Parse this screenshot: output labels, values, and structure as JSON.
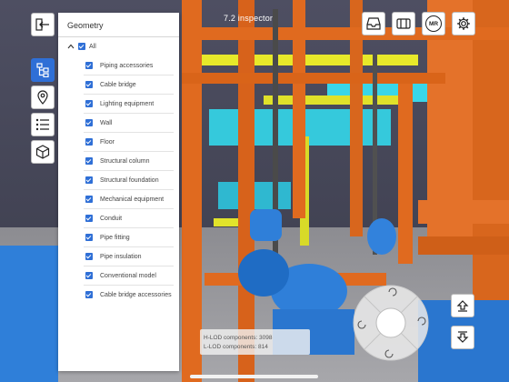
{
  "window": {
    "title": "7.2 inspector"
  },
  "left_toolbar": {
    "back_icon": "exit-arrow-icon",
    "items": [
      {
        "icon": "tree-hierarchy-icon",
        "active": true
      },
      {
        "icon": "location-pin-icon",
        "active": false
      },
      {
        "icon": "list-icon",
        "active": false
      },
      {
        "icon": "cube-icon",
        "active": false
      }
    ]
  },
  "top_right_toolbar": {
    "items": [
      {
        "icon": "inbox-tray-icon"
      },
      {
        "icon": "split-view-icon"
      },
      {
        "icon": "mr-icon",
        "label": "MR"
      },
      {
        "icon": "gear-icon"
      }
    ]
  },
  "geometry_panel": {
    "title": "Geometry",
    "root": {
      "label": "All",
      "checked": true,
      "expanded": true
    },
    "items": [
      {
        "label": "Piping accessories",
        "checked": true
      },
      {
        "label": "Cable bridge",
        "checked": true
      },
      {
        "label": "Lighting equipment",
        "checked": true
      },
      {
        "label": "Wall",
        "checked": true
      },
      {
        "label": "Floor",
        "checked": true
      },
      {
        "label": "Structural column",
        "checked": true
      },
      {
        "label": "Structural foundation",
        "checked": true
      },
      {
        "label": "Mechanical equipment",
        "checked": true
      },
      {
        "label": "Conduit",
        "checked": true
      },
      {
        "label": "Pipe fitting",
        "checked": true
      },
      {
        "label": "Pipe insulation",
        "checked": true
      },
      {
        "label": "Conventional model",
        "checked": true
      },
      {
        "label": "Cable bridge accessories",
        "checked": true
      }
    ]
  },
  "lod_info": {
    "line1": "H-LOD components: 3098",
    "line2": "L-LOD components: 814"
  },
  "nav_controls": {
    "up": "level-up-icon",
    "down": "level-down-icon",
    "joystick": "orbit-joystick-icon"
  },
  "colors": {
    "pipe_orange": "#e06a1f",
    "pipe_blue": "#2f7fd9",
    "pipe_yellow": "#e7e92a",
    "pipe_cyan": "#39d6e8",
    "accent": "#2f6fd6"
  }
}
